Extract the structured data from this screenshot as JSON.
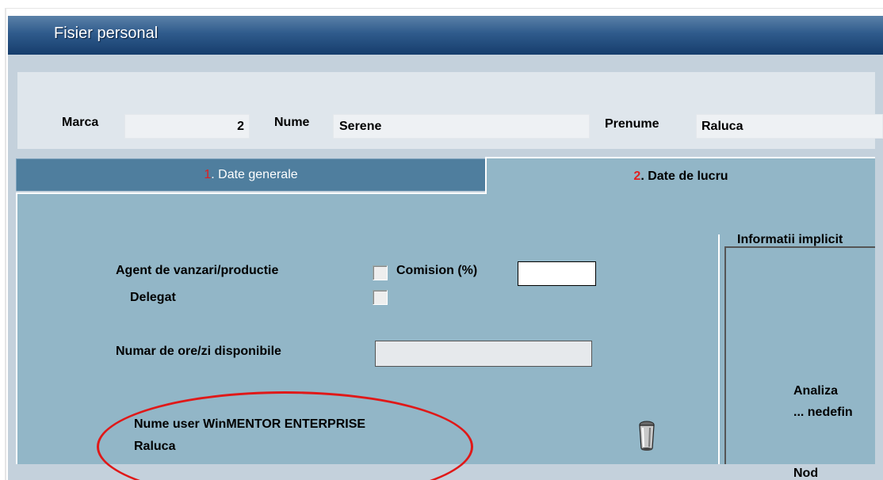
{
  "window": {
    "title": "Fisier personal"
  },
  "header": {
    "marca_label": "Marca",
    "marca_value": "2",
    "nume_label": "Nume",
    "nume_value": "Serene",
    "prenume_label": "Prenume",
    "prenume_value": "Raluca"
  },
  "tabs": [
    {
      "num": "1",
      "label": ". Date generale"
    },
    {
      "num": "2",
      "label": ". Date de lucru"
    }
  ],
  "body": {
    "agent_label": "Agent de vanzari/productie",
    "comision_label": "Comision (%)",
    "comision_value": "",
    "delegat_label": "Delegat",
    "ore_label": "Numar de ore/zi disponibile",
    "ore_value": "",
    "user_label": "Nume user WinMENTOR ENTERPRISE",
    "user_value": "Raluca",
    "info_title": "Informatii implicit",
    "analiza_label": "Analiza",
    "analiza_value": "... nedefin",
    "nod_label": "Nod"
  },
  "icons": {
    "delete": "trash-icon"
  },
  "colors": {
    "highlight": "#e01818",
    "tab_active": "#92b6c7",
    "tab_inactive": "#4f7e9e"
  }
}
